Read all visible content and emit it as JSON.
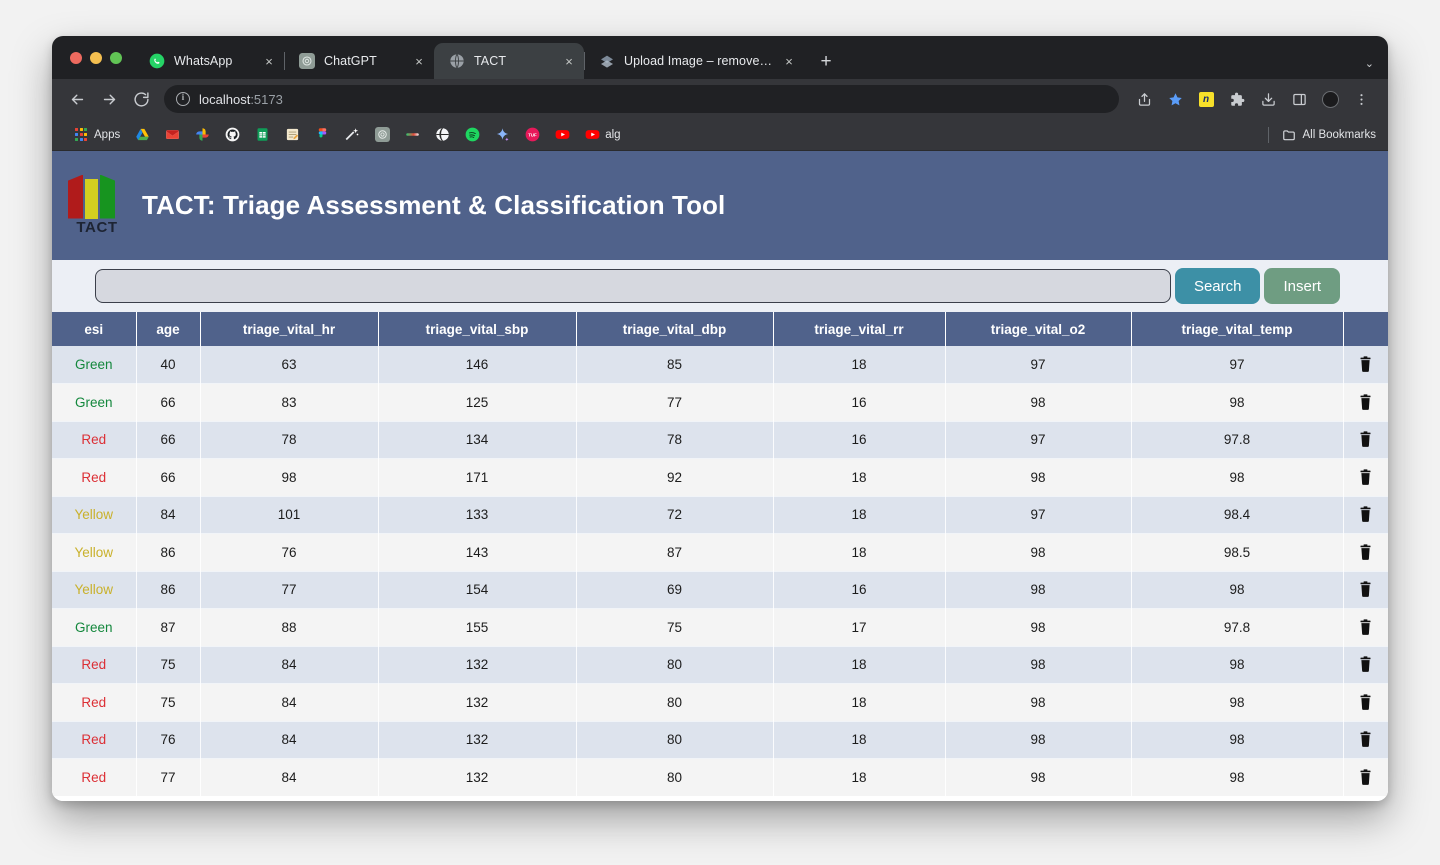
{
  "browser": {
    "tabs": [
      {
        "title": "WhatsApp",
        "favicon": "whatsapp-icon",
        "active": false,
        "close_label": "×"
      },
      {
        "title": "ChatGPT",
        "favicon": "chatgpt-icon",
        "active": false,
        "close_label": "×"
      },
      {
        "title": "TACT",
        "favicon": "globe-icon",
        "active": true,
        "close_label": "×"
      },
      {
        "title": "Upload Image – remove.bg",
        "favicon": "removebg-icon",
        "active": false,
        "close_label": "×"
      }
    ],
    "new_tab_label": "+",
    "tab_list_label": "⌄",
    "nav": {
      "back": "←",
      "forward": "→",
      "reload": "⟳"
    },
    "omnibox": {
      "info_label": "i",
      "url_host": "localhost",
      "url_port": ":5173",
      "value": "localhost:5173"
    },
    "toolbar_right": [
      {
        "name": "share-icon",
        "glyph": "↑"
      },
      {
        "name": "bookmark-star-icon",
        "glyph": "★"
      },
      {
        "name": "extension-yellow-icon",
        "glyph": "n"
      },
      {
        "name": "puzzle-extension-icon",
        "glyph": "✦"
      },
      {
        "name": "download-icon",
        "glyph": "⤓"
      },
      {
        "name": "side-panel-icon",
        "glyph": "▣"
      },
      {
        "name": "profile-avatar",
        "glyph": ""
      },
      {
        "name": "chrome-menu-icon",
        "glyph": "⋮"
      }
    ],
    "bookmarks": {
      "apps_label": "Apps",
      "items": [
        {
          "name": "google-drive-bookmark",
          "label": "",
          "color": "#1aa463",
          "glyph": "▲"
        },
        {
          "name": "gmail-bookmark",
          "label": "",
          "color": "#ea4335",
          "glyph": "M"
        },
        {
          "name": "google-photos-bookmark",
          "label": "",
          "color": "#4285f4",
          "glyph": "✿"
        },
        {
          "name": "github-bookmark",
          "label": "",
          "color": "#ffffff",
          "glyph": "●"
        },
        {
          "name": "google-sheets-bookmark",
          "label": "",
          "color": "#0f9d58",
          "glyph": "+"
        },
        {
          "name": "notes-bookmark",
          "label": "",
          "color": "#f0e4c8",
          "glyph": "✎"
        },
        {
          "name": "figma-bookmark",
          "label": "",
          "color": "#f24e1e",
          "glyph": "F"
        },
        {
          "name": "magic-wand-bookmark",
          "label": "",
          "color": "#e8e8e8",
          "glyph": "✧"
        },
        {
          "name": "chatgpt-bookmark",
          "label": "",
          "color": "#9aa39e",
          "glyph": "◎"
        },
        {
          "name": "gradient-bar-bookmark",
          "label": "",
          "color": "#5de0a0",
          "glyph": "▬"
        },
        {
          "name": "globe-bookmark",
          "label": "",
          "color": "#ffffff",
          "glyph": "⊕"
        },
        {
          "name": "spotify-bookmark",
          "label": "",
          "color": "#1ed760",
          "glyph": "♫"
        },
        {
          "name": "gemini-bookmark",
          "label": "",
          "color": "#8ab4f8",
          "glyph": "✦"
        },
        {
          "name": "pink-circle-bookmark",
          "label": "",
          "color": "#e7195a",
          "glyph": "●"
        },
        {
          "name": "youtube-bookmark",
          "label": "",
          "color": "#ff0000",
          "glyph": "▶"
        },
        {
          "name": "alg-bookmark",
          "label": "alg",
          "color": "#ff0000",
          "glyph": ""
        }
      ],
      "all_bookmarks_label": "All Bookmarks"
    }
  },
  "app": {
    "logo_text": "TACT",
    "title": "TACT: Triage Assessment & Classification Tool",
    "header_color": "#50628b",
    "search": {
      "value": "",
      "placeholder": ""
    },
    "buttons": {
      "search_label": "Search",
      "search_color": "#3d90a6",
      "insert_label": "Insert",
      "insert_color": "#6f9d82"
    }
  },
  "table": {
    "columns": [
      "esi",
      "age",
      "triage_vital_hr",
      "triage_vital_sbp",
      "triage_vital_dbp",
      "triage_vital_rr",
      "triage_vital_o2",
      "triage_vital_temp",
      ""
    ],
    "delete_icon": "trash-icon",
    "esi_colors": {
      "Green": "#13873c",
      "Red": "#dc2f35",
      "Yellow": "#c9b12b"
    },
    "rows": [
      {
        "esi": "Green",
        "age": "40",
        "hr": "63",
        "sbp": "146",
        "dbp": "85",
        "rr": "18",
        "o2": "97",
        "temp": "97"
      },
      {
        "esi": "Green",
        "age": "66",
        "hr": "83",
        "sbp": "125",
        "dbp": "77",
        "rr": "16",
        "o2": "98",
        "temp": "98"
      },
      {
        "esi": "Red",
        "age": "66",
        "hr": "78",
        "sbp": "134",
        "dbp": "78",
        "rr": "16",
        "o2": "97",
        "temp": "97.8"
      },
      {
        "esi": "Red",
        "age": "66",
        "hr": "98",
        "sbp": "171",
        "dbp": "92",
        "rr": "18",
        "o2": "98",
        "temp": "98"
      },
      {
        "esi": "Yellow",
        "age": "84",
        "hr": "101",
        "sbp": "133",
        "dbp": "72",
        "rr": "18",
        "o2": "97",
        "temp": "98.4"
      },
      {
        "esi": "Yellow",
        "age": "86",
        "hr": "76",
        "sbp": "143",
        "dbp": "87",
        "rr": "18",
        "o2": "98",
        "temp": "98.5"
      },
      {
        "esi": "Yellow",
        "age": "86",
        "hr": "77",
        "sbp": "154",
        "dbp": "69",
        "rr": "16",
        "o2": "98",
        "temp": "98"
      },
      {
        "esi": "Green",
        "age": "87",
        "hr": "88",
        "sbp": "155",
        "dbp": "75",
        "rr": "17",
        "o2": "98",
        "temp": "97.8"
      },
      {
        "esi": "Red",
        "age": "75",
        "hr": "84",
        "sbp": "132",
        "dbp": "80",
        "rr": "18",
        "o2": "98",
        "temp": "98"
      },
      {
        "esi": "Red",
        "age": "75",
        "hr": "84",
        "sbp": "132",
        "dbp": "80",
        "rr": "18",
        "o2": "98",
        "temp": "98"
      },
      {
        "esi": "Red",
        "age": "76",
        "hr": "84",
        "sbp": "132",
        "dbp": "80",
        "rr": "18",
        "o2": "98",
        "temp": "98"
      },
      {
        "esi": "Red",
        "age": "77",
        "hr": "84",
        "sbp": "132",
        "dbp": "80",
        "rr": "18",
        "o2": "98",
        "temp": "98"
      }
    ]
  }
}
